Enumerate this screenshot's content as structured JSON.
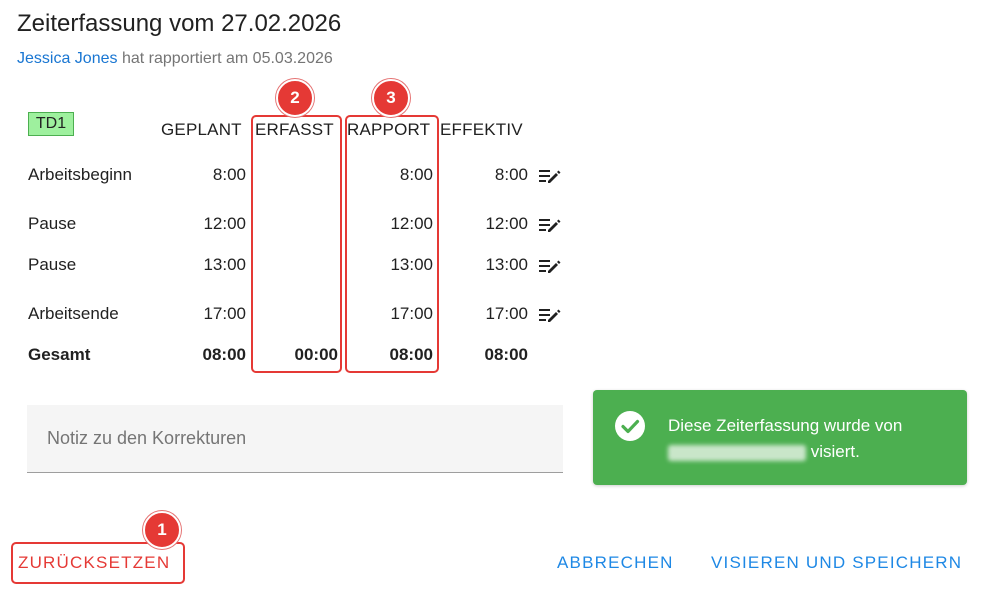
{
  "header": {
    "title": "Zeiterfassung vom 27.02.2026",
    "user": "Jessica Jones",
    "reported_text": "hat rapportiert am 05.03.2026"
  },
  "table": {
    "tag": "TD1",
    "columns": [
      "GEPLANT",
      "ERFASST",
      "RAPPORT",
      "EFFEKTIV"
    ],
    "rows": [
      {
        "label": "Arbeitsbeginn",
        "geplant": "8:00",
        "erfasst": "",
        "rapport": "8:00",
        "effektiv": "8:00"
      },
      {
        "label": "Pause",
        "geplant": "12:00",
        "erfasst": "",
        "rapport": "12:00",
        "effektiv": "12:00"
      },
      {
        "label": "Pause",
        "geplant": "13:00",
        "erfasst": "",
        "rapport": "13:00",
        "effektiv": "13:00"
      },
      {
        "label": "Arbeitsende",
        "geplant": "17:00",
        "erfasst": "",
        "rapport": "17:00",
        "effektiv": "17:00"
      }
    ],
    "total": {
      "label": "Gesamt",
      "geplant": "08:00",
      "erfasst": "00:00",
      "rapport": "08:00",
      "effektiv": "08:00"
    }
  },
  "markers": [
    "1",
    "2",
    "3"
  ],
  "note": {
    "placeholder": "Notiz zu den Korrekturen",
    "value": ""
  },
  "toast": {
    "line1": "Diese Zeiterfassung wurde von",
    "line2_suffix": "visiert.",
    "icon": "check-circle-icon",
    "color": "#4caf50"
  },
  "actions": {
    "reset": "ZURÜCKSETZEN",
    "cancel": "ABBRECHEN",
    "save": "VISIEREN UND SPEICHERN"
  }
}
